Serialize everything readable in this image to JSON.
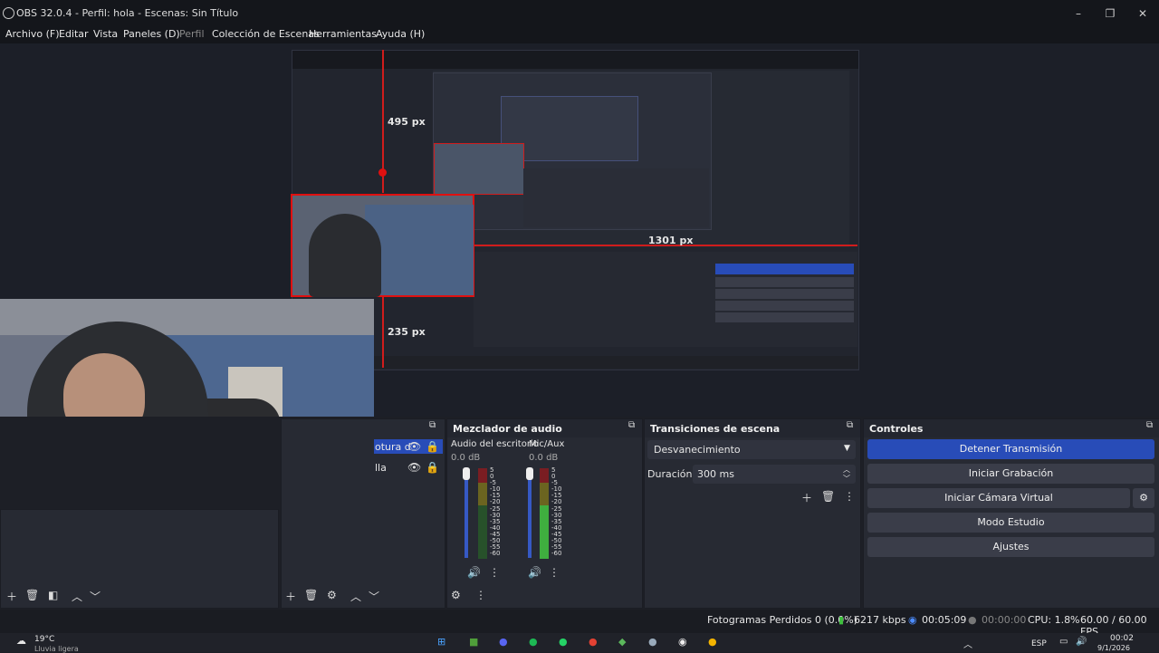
{
  "window": {
    "title": "OBS 32.0.4 - Perfil: hola - Escenas: Sin Título"
  },
  "menu": [
    "Archivo (F)",
    "Editar",
    "Vista",
    "Paneles (D)",
    "Perfil",
    "Colección de Escenas",
    "Herramientas",
    "Ayuda (H)"
  ],
  "preview": {
    "measure_top": "495 px",
    "measure_right": "1301 px",
    "measure_bottom": "235 px"
  },
  "sources": {
    "items": [
      "otura d",
      "lla"
    ]
  },
  "mixer": {
    "title": "Mezclador de audio",
    "channels": [
      {
        "name": "Audio del escritorio",
        "db": "0.0 dB"
      },
      {
        "name": "Mic/Aux",
        "db": "0.0 dB"
      }
    ],
    "scale": [
      "5",
      "0",
      "-5",
      "-10",
      "-15",
      "-20",
      "-25",
      "-30",
      "-35",
      "-40",
      "-45",
      "-50",
      "-55",
      "-60"
    ]
  },
  "transitions": {
    "title": "Transiciones de escena",
    "selected": "Desvanecimiento",
    "duration_label": "Duración",
    "duration_value": "300 ms"
  },
  "controls": {
    "title": "Controles",
    "buttons": [
      "Detener Transmisión",
      "Iniciar Grabación",
      "Iniciar Cámara Virtual",
      "Modo Estudio",
      "Ajustes"
    ]
  },
  "status": {
    "frames_lost": "Fotogramas Perdidos 0 (0.0%)",
    "kbps": "6217 kbps",
    "stream_time": "00:05:09",
    "rec_time": "00:00:00",
    "cpu": "CPU: 1.8%",
    "fps": "60.00 / 60.00 FPS"
  },
  "taskbar": {
    "weather_temp": "19°C",
    "weather_desc": "Lluvia ligera",
    "lang": "ESP",
    "time": "00:02",
    "date": "9/1/2026"
  },
  "colors": {
    "accent": "#284cb8",
    "guide": "#e01010"
  }
}
